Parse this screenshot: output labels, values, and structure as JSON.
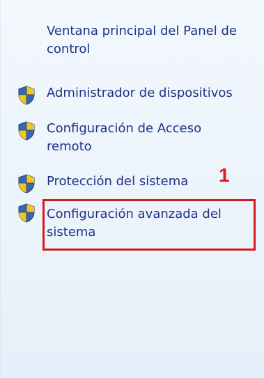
{
  "sidebar": {
    "main_link": {
      "line1": "Ventana principal del Panel de",
      "line2": "control"
    },
    "items": [
      {
        "label_line1": "Administrador de dispositivos",
        "label_line2": "",
        "icon": "uac-shield-icon"
      },
      {
        "label_line1": "Configuración de Acceso",
        "label_line2": "remoto",
        "icon": "uac-shield-icon"
      },
      {
        "label_line1": "Protección del sistema",
        "label_line2": "",
        "icon": "uac-shield-icon"
      },
      {
        "label_line1": "Configuración avanzada del",
        "label_line2": "sistema",
        "icon": "uac-shield-icon"
      }
    ]
  },
  "annotation": {
    "number": "1",
    "color": "#e3191b"
  },
  "colors": {
    "link": "#1e3287",
    "panel_top": "#f3f8fd",
    "panel_bottom": "#e6f0fa"
  }
}
